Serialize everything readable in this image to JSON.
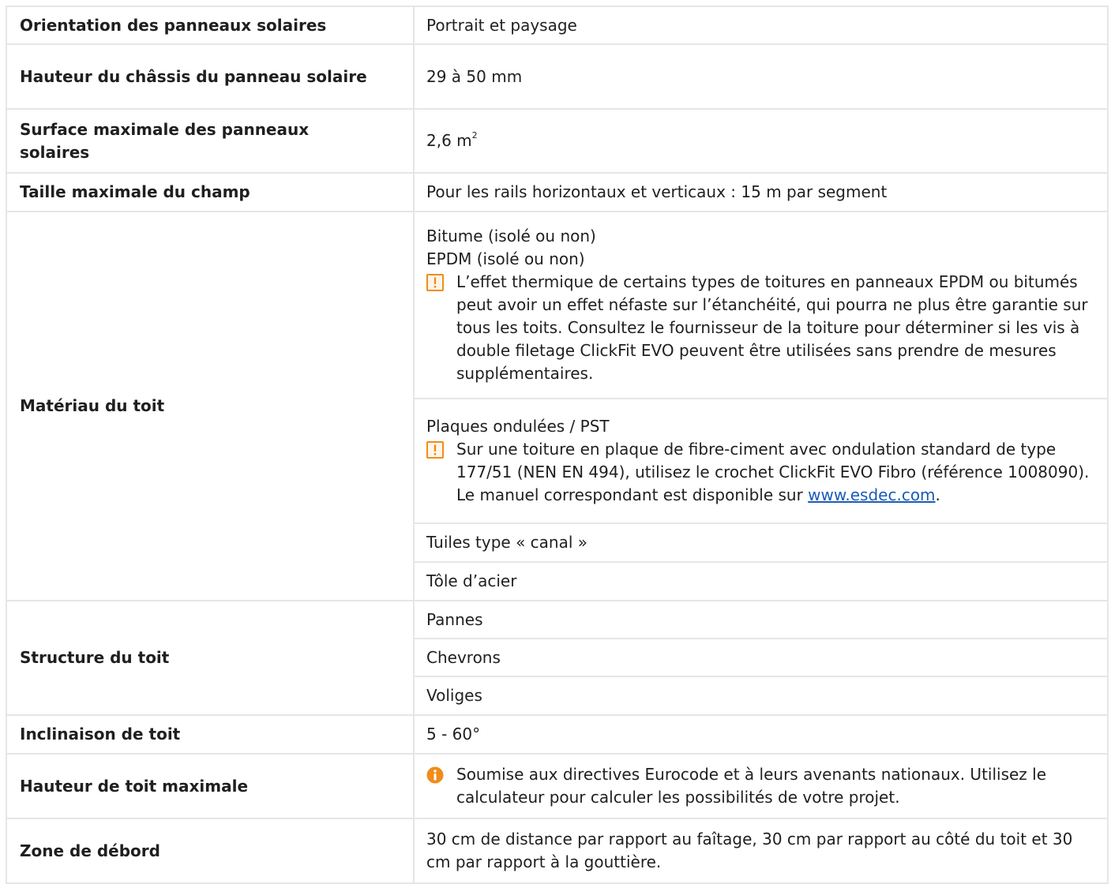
{
  "rows": {
    "orientation": {
      "label": "Orientation des panneaux solaires",
      "value": "Portrait et paysage"
    },
    "frame_height": {
      "label": "Hauteur du châssis du panneau solaire",
      "value": "29 à 50 mm"
    },
    "max_surface": {
      "label": "Surface maximale des panneaux solaires",
      "value": "2,6 m",
      "value_sup": "2"
    },
    "field_size": {
      "label": "Taille maximale du champ",
      "value": "Pour les rails horizontaux et verticaux : 15 m par segment"
    },
    "roof_material": {
      "label": "Matériau du toit",
      "bitumen": "Bitume (isolé ou non)",
      "epdm": "EPDM (isolé ou non)",
      "epdm_warning": "L’effet thermique de certains types de toitures en panneaux EPDM ou bitumés peut avoir un effet néfaste sur l’étanchéité, qui pourra ne plus être garantie sur tous les toits. Consultez le fournisseur de la toiture pour déterminer si les vis à double filetage ClickFit EVO peuvent être utilisées sans prendre de mesures supplémentaires.",
      "corrugated": "Plaques ondulées / PST",
      "corrugated_warning": "Sur une toiture en plaque de fibre-ciment avec ondulation standard de type 177/51 (NEN EN 494), utilisez le crochet ClickFit EVO Fibro (référence 1008090). Le manuel correspondant est disponible sur ",
      "corrugated_link": "www.esdec.com",
      "corrugated_end": ".",
      "tiles": "Tuiles type « canal »",
      "steel": "Tôle d’acier"
    },
    "roof_structure": {
      "label": "Structure du toit",
      "purlins": "Pannes",
      "rafters": "Chevrons",
      "battens": "Voliges"
    },
    "pitch": {
      "label": "Inclinaison de toit",
      "value": "5 - 60°"
    },
    "max_height": {
      "label": "Hauteur de toit maximale",
      "info": "Soumise aux directives Eurocode et à leurs avenants nationaux. Utilisez le calculateur pour calculer les possibilités de votre projet."
    },
    "edge_zone": {
      "label": "Zone de débord",
      "value": "30 cm de distance par rapport au faîtage, 30 cm par rapport au côté du toit et 30 cm par rapport à la gouttière."
    }
  },
  "icons": {
    "warning": "warning-icon",
    "info": "info-icon",
    "warning_color": "#f08c1a",
    "info_color": "#f08c1a"
  }
}
